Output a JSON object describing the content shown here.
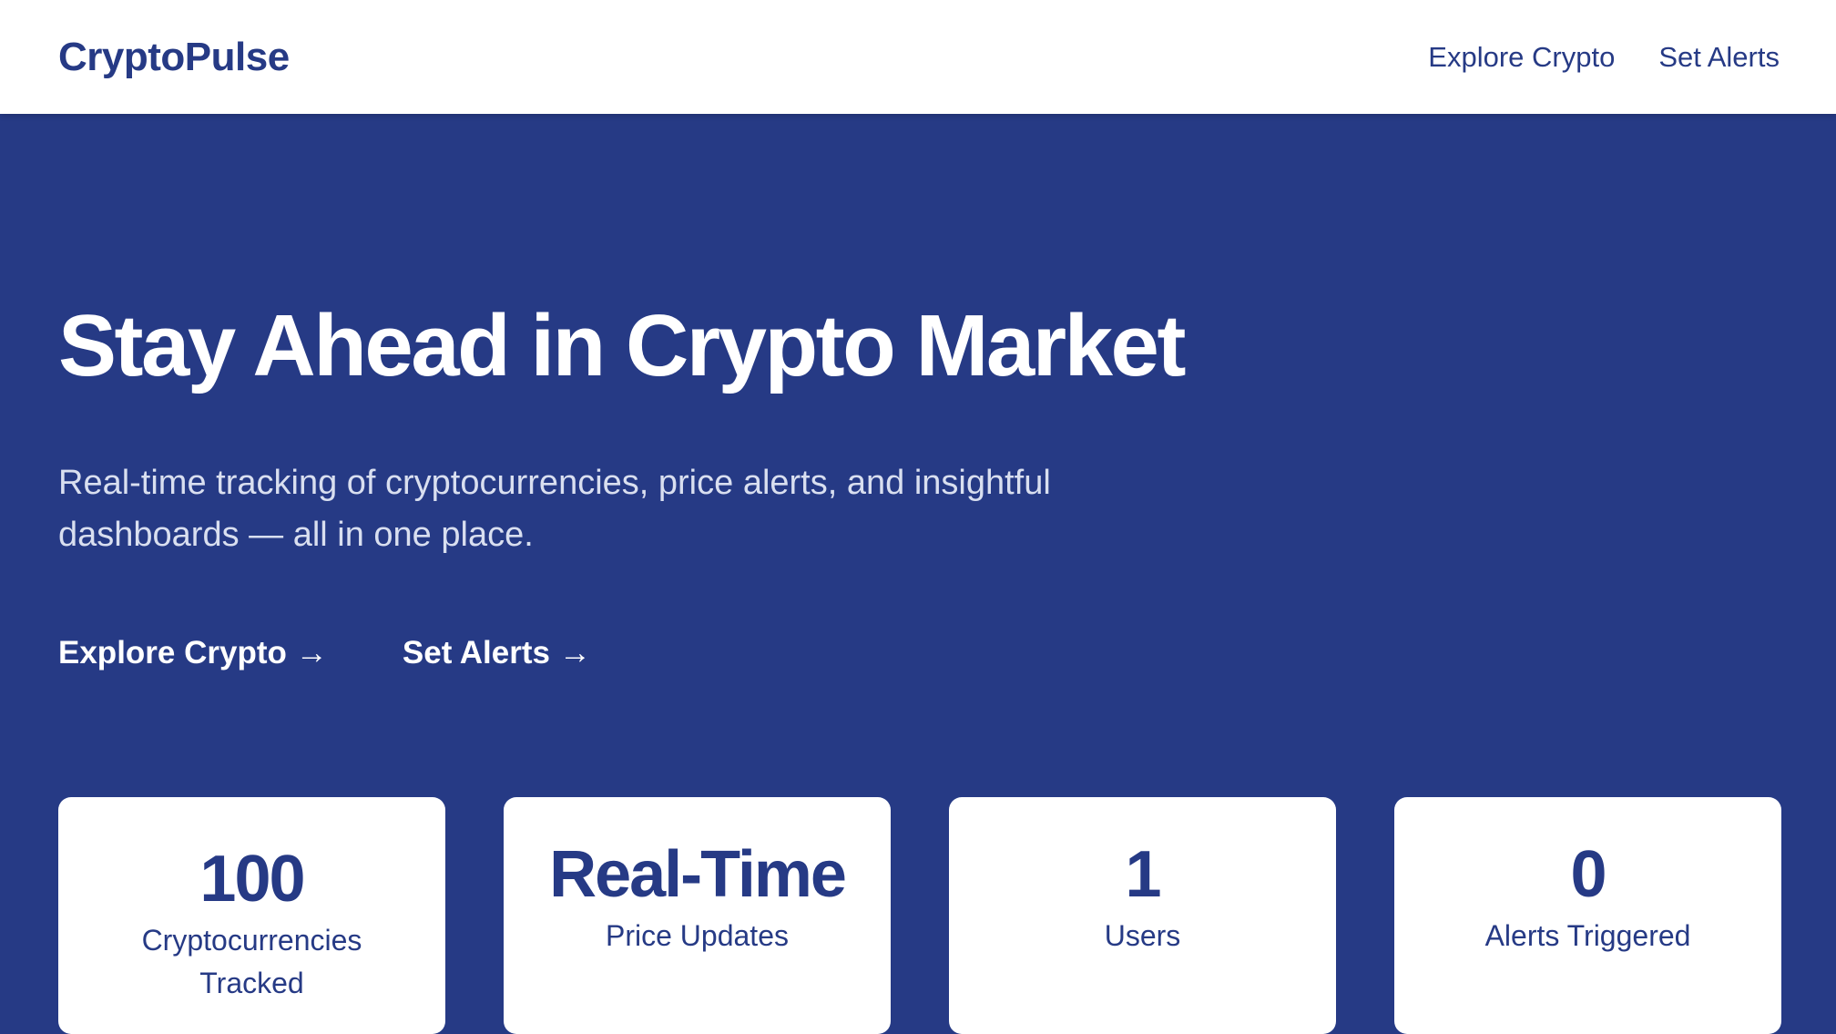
{
  "nav": {
    "brand": "CryptoPulse",
    "links": [
      {
        "label": "Explore Crypto"
      },
      {
        "label": "Set Alerts"
      }
    ]
  },
  "hero": {
    "title": "Stay Ahead in Crypto Market",
    "subtitle": "Real-time tracking of cryptocurrencies, price alerts, and insightful dashboards — all in one place.",
    "ctas": [
      {
        "label": "Explore Crypto",
        "arrow": "→"
      },
      {
        "label": "Set Alerts",
        "arrow": "→"
      }
    ]
  },
  "stats": [
    {
      "value": "100",
      "label": "Cryptocurrencies Tracked"
    },
    {
      "value": "Real-Time",
      "label": "Price Updates"
    },
    {
      "value": "1",
      "label": "Users"
    },
    {
      "value": "0",
      "label": "Alerts Triggered"
    }
  ],
  "colors": {
    "brand": "#263a85",
    "surface": "#ffffff",
    "subtitle": "#d9dff0"
  }
}
